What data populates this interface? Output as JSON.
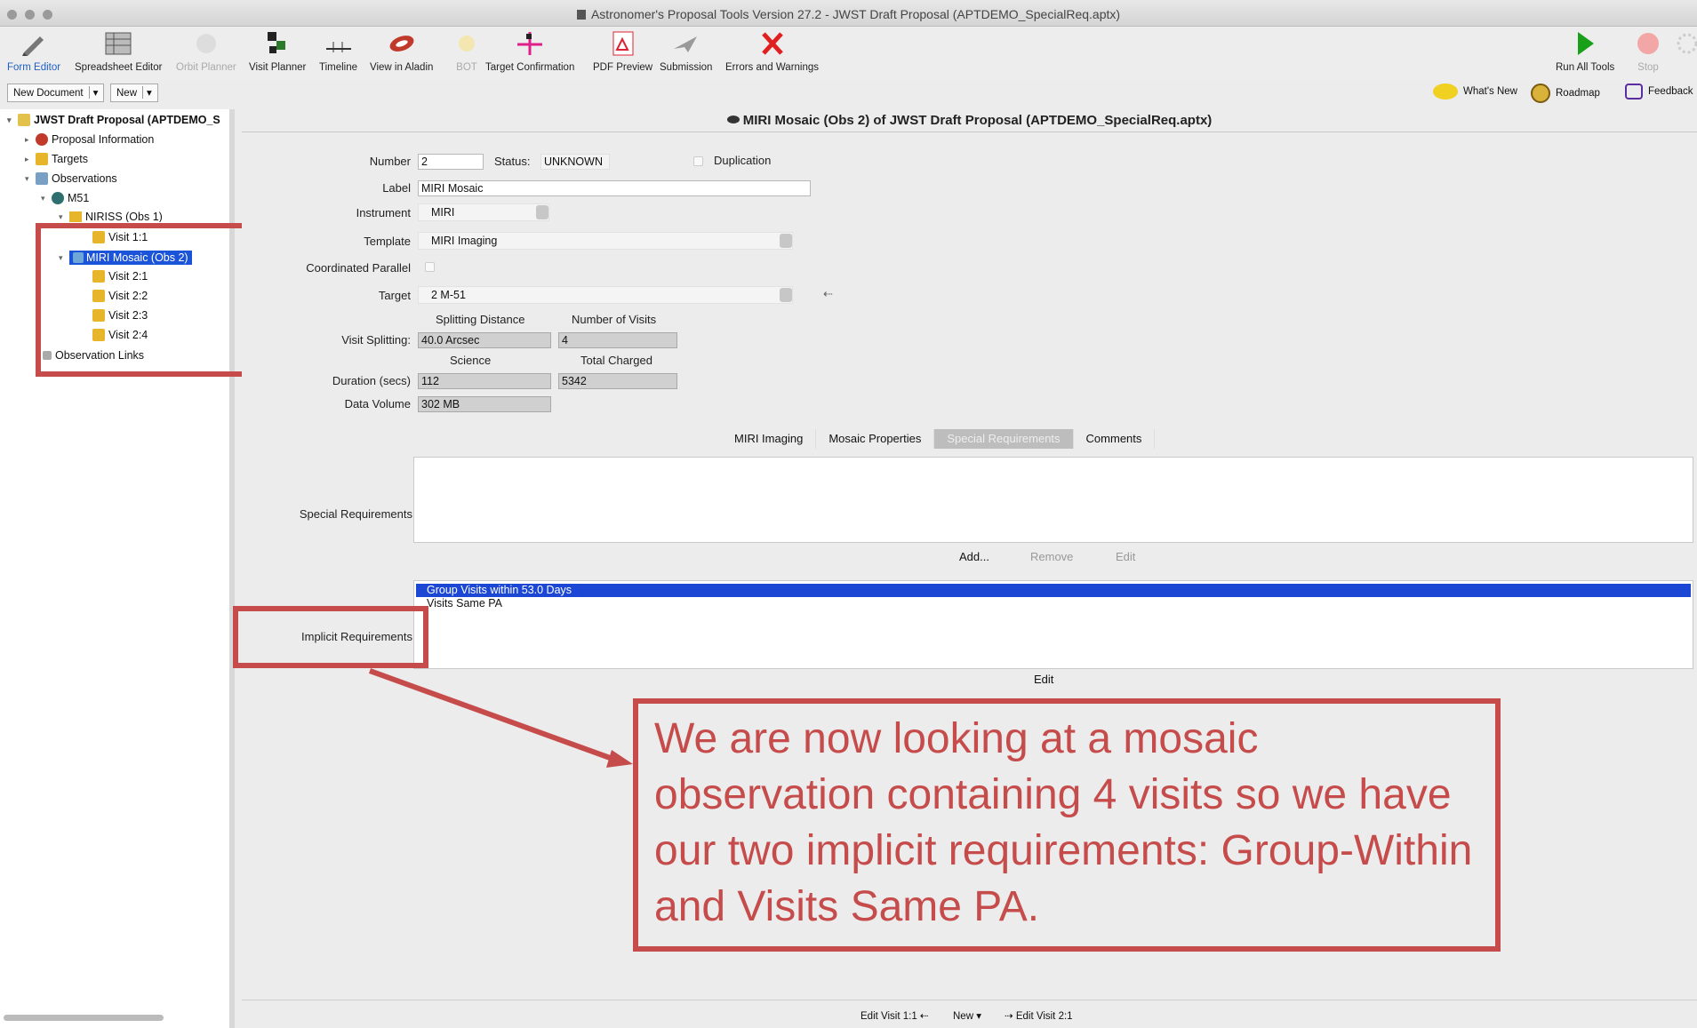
{
  "window": {
    "title": "Astronomer's Proposal Tools Version 27.2  - JWST Draft Proposal (APTDEMO_SpecialReq.aptx)"
  },
  "toolbar": {
    "tools": [
      {
        "label": "Form Editor",
        "icon": "form-editor-icon"
      },
      {
        "label": "Spreadsheet Editor",
        "icon": "spreadsheet-icon"
      },
      {
        "label": "Orbit Planner",
        "icon": "orbit-planner-icon"
      },
      {
        "label": "Visit Planner",
        "icon": "visit-planner-icon"
      },
      {
        "label": "Timeline",
        "icon": "timeline-icon"
      },
      {
        "label": "View in Aladin",
        "icon": "aladin-icon"
      },
      {
        "label": "BOT",
        "icon": "bot-icon"
      },
      {
        "label": "Target Confirmation",
        "icon": "target-confirmation-icon"
      },
      {
        "label": "PDF Preview",
        "icon": "pdf-icon"
      },
      {
        "label": "Submission",
        "icon": "submission-icon"
      },
      {
        "label": "Errors and Warnings",
        "icon": "errors-icon"
      },
      {
        "label": "Run All Tools",
        "icon": "run-icon"
      },
      {
        "label": "Stop",
        "icon": "stop-icon"
      }
    ],
    "new_document": "New Document",
    "new": "New",
    "whats_new": "What's New",
    "roadmap": "Roadmap",
    "feedback": "Feedback"
  },
  "tree": {
    "root": "JWST Draft Proposal (APTDEMO_S",
    "proposal_information": "Proposal Information",
    "targets": "Targets",
    "observations": "Observations",
    "m51": "M51",
    "niriss": "NIRISS (Obs 1)",
    "visit_1_1": "Visit 1:1",
    "miri_mosaic": "MIRI Mosaic (Obs 2)",
    "visit_2_1": "Visit 2:1",
    "visit_2_2": "Visit 2:2",
    "visit_2_3": "Visit 2:3",
    "visit_2_4": "Visit 2:4",
    "observation_links": "Observation Links"
  },
  "main": {
    "title": "MIRI Mosaic (Obs 2) of JWST Draft Proposal (APTDEMO_SpecialReq.aptx)",
    "number_label": "Number",
    "number_value": "2",
    "status_label": "Status:",
    "status_value": "UNKNOWN",
    "duplication_label": "Duplication",
    "label_label": "Label",
    "label_value": "MIRI Mosaic",
    "instrument_label": "Instrument",
    "instrument_value": "MIRI",
    "template_label": "Template",
    "template_value": "MIRI Imaging",
    "coordinated_parallel_label": "Coordinated Parallel",
    "target_label": "Target",
    "target_value": "2 M-51",
    "splitting_distance_label": "Splitting Distance",
    "number_of_visits_label": "Number of Visits",
    "visit_splitting_label": "Visit Splitting:",
    "splitting_distance_value": "40.0 Arcsec",
    "number_of_visits_value": "4",
    "science_label": "Science",
    "total_charged_label": "Total Charged",
    "duration_label": "Duration (secs)",
    "science_value": "112",
    "total_charged_value": "5342",
    "data_volume_label": "Data Volume",
    "data_volume_value": "302 MB",
    "tabs": [
      "MIRI Imaging",
      "Mosaic Properties",
      "Special Requirements",
      "Comments"
    ],
    "special_requirements_label": "Special Requirements",
    "add_button": "Add...",
    "remove_button": "Remove",
    "edit_button": "Edit",
    "implicit_requirements_label": "Implicit Requirements",
    "implicit_items": [
      "Group Visits within 53.0 Days",
      "Visits Same PA"
    ],
    "implicit_edit_button": "Edit"
  },
  "annotation": {
    "callout_text": "We are now looking at a mosaic observation containing 4 visits so we have our two implicit requirements: Group-Within and Visits Same PA.",
    "color": "#c64b4b"
  },
  "bottom_bar": {
    "edit_visit_prev": "Edit Visit 1:1",
    "new": "New",
    "edit_visit_next": "Edit Visit 2:1"
  }
}
